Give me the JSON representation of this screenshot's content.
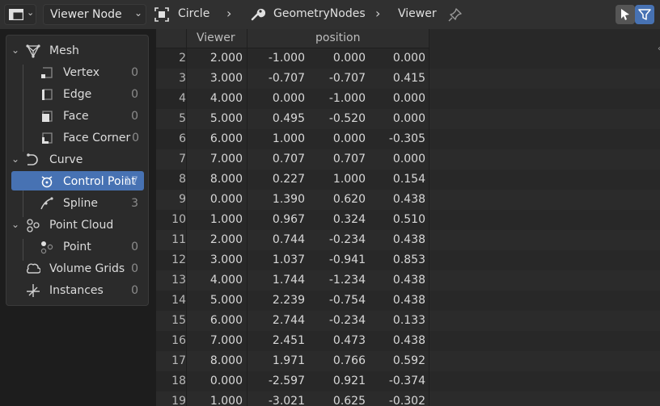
{
  "header": {
    "editor_type_icon": "spreadsheet-icon",
    "dropdown_label": "Viewer Node",
    "breadcrumbs": [
      "Circle",
      "GeometryNodes",
      "Viewer"
    ],
    "icons": [
      "object-icon",
      "wrench-icon",
      "pin-icon",
      "select-icon",
      "filter-icon"
    ],
    "colors": {
      "header_bg": "#303030",
      "accent": "#4772b3"
    }
  },
  "panel": {
    "items": [
      {
        "label": "Mesh",
        "count": "",
        "icon": "mesh-icon",
        "level": 0
      },
      {
        "label": "Vertex",
        "count": "0",
        "icon": "vertex-icon",
        "level": 1
      },
      {
        "label": "Edge",
        "count": "0",
        "icon": "edge-icon",
        "level": 1
      },
      {
        "label": "Face",
        "count": "0",
        "icon": "face-icon",
        "level": 1
      },
      {
        "label": "Face Corner",
        "count": "0",
        "icon": "face-corner-icon",
        "level": 1
      },
      {
        "label": "Curve",
        "count": "",
        "icon": "curve-icon",
        "level": 0
      },
      {
        "label": "Control Point",
        "count": "17",
        "icon": "control-point-icon",
        "level": 1,
        "selected": true
      },
      {
        "label": "Spline",
        "count": "3",
        "icon": "spline-icon",
        "level": 1
      },
      {
        "label": "Point Cloud",
        "count": "",
        "icon": "point-cloud-icon",
        "level": 0
      },
      {
        "label": "Point",
        "count": "0",
        "icon": "point-icon",
        "level": 1
      },
      {
        "label": "Volume Grids",
        "count": "0",
        "icon": "volume-icon",
        "level": 0
      },
      {
        "label": "Instances",
        "count": "0",
        "icon": "instances-icon",
        "level": 0
      }
    ]
  },
  "sheet": {
    "columns": [
      "Viewer",
      "position"
    ],
    "rows": [
      {
        "i": "2",
        "v": "2.000",
        "x": "-1.000",
        "y": "0.000",
        "z": "0.000"
      },
      {
        "i": "3",
        "v": "3.000",
        "x": "-0.707",
        "y": "-0.707",
        "z": "0.415"
      },
      {
        "i": "4",
        "v": "4.000",
        "x": "0.000",
        "y": "-1.000",
        "z": "0.000"
      },
      {
        "i": "5",
        "v": "5.000",
        "x": "0.495",
        "y": "-0.520",
        "z": "0.000"
      },
      {
        "i": "6",
        "v": "6.000",
        "x": "1.000",
        "y": "0.000",
        "z": "-0.305"
      },
      {
        "i": "7",
        "v": "7.000",
        "x": "0.707",
        "y": "0.707",
        "z": "0.000"
      },
      {
        "i": "8",
        "v": "8.000",
        "x": "0.227",
        "y": "1.000",
        "z": "0.154"
      },
      {
        "i": "9",
        "v": "0.000",
        "x": "1.390",
        "y": "0.620",
        "z": "0.438"
      },
      {
        "i": "10",
        "v": "1.000",
        "x": "0.967",
        "y": "0.324",
        "z": "0.510"
      },
      {
        "i": "11",
        "v": "2.000",
        "x": "0.744",
        "y": "-0.234",
        "z": "0.438"
      },
      {
        "i": "12",
        "v": "3.000",
        "x": "1.037",
        "y": "-0.941",
        "z": "0.853"
      },
      {
        "i": "13",
        "v": "4.000",
        "x": "1.744",
        "y": "-1.234",
        "z": "0.438"
      },
      {
        "i": "14",
        "v": "5.000",
        "x": "2.239",
        "y": "-0.754",
        "z": "0.438"
      },
      {
        "i": "15",
        "v": "6.000",
        "x": "2.744",
        "y": "-0.234",
        "z": "0.133"
      },
      {
        "i": "16",
        "v": "7.000",
        "x": "2.451",
        "y": "0.473",
        "z": "0.438"
      },
      {
        "i": "17",
        "v": "8.000",
        "x": "1.971",
        "y": "0.766",
        "z": "0.592"
      },
      {
        "i": "18",
        "v": "0.000",
        "x": "-2.597",
        "y": "0.921",
        "z": "-0.374"
      },
      {
        "i": "19",
        "v": "1.000",
        "x": "-3.021",
        "y": "0.625",
        "z": "-0.302"
      }
    ]
  }
}
